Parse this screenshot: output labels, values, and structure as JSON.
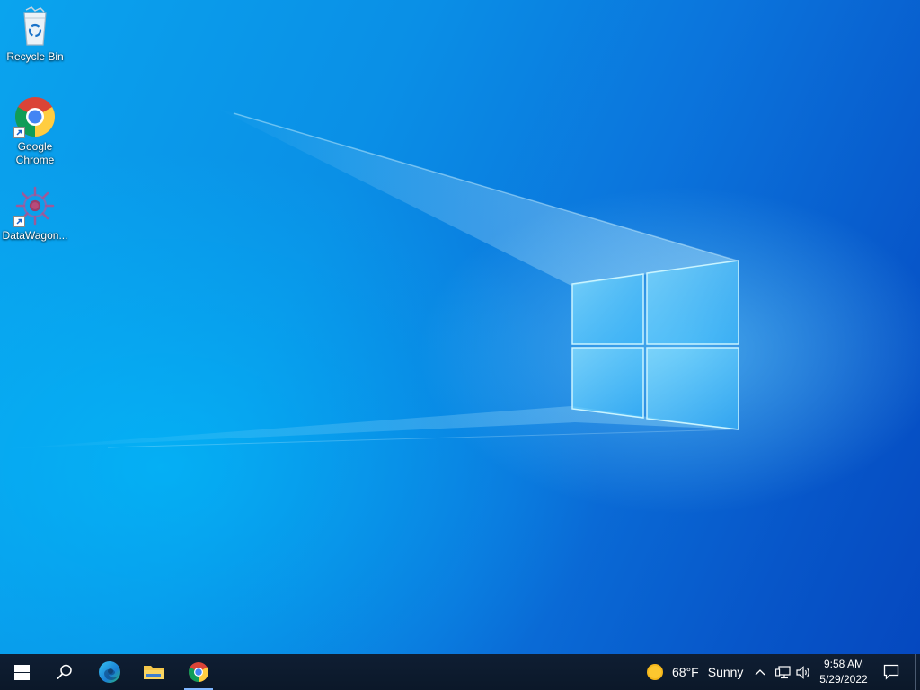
{
  "desktop": {
    "icons": [
      {
        "label": "Recycle Bin",
        "icon": "recycle-bin-icon"
      },
      {
        "label": "Google Chrome",
        "icon": "chrome-icon"
      },
      {
        "label": "DataWagon...",
        "icon": "datawagon-icon"
      }
    ],
    "wallpaper": "windows-10-logo-light-beams",
    "colors": {
      "wallpaper_light": "#0aa4ee",
      "wallpaper_dark": "#0548bf"
    }
  },
  "taskbar": {
    "pinned": [
      {
        "name": "start",
        "icon": "windows-start-icon"
      },
      {
        "name": "search",
        "icon": "search-icon"
      },
      {
        "name": "edge",
        "icon": "edge-icon"
      },
      {
        "name": "file-explorer",
        "icon": "folder-icon"
      },
      {
        "name": "chrome",
        "icon": "chrome-icon"
      }
    ],
    "weather": {
      "temp": "68°F",
      "condition": "Sunny",
      "icon": "sun-icon"
    },
    "tray": {
      "icons": [
        "chevron-up-icon",
        "network-icon",
        "volume-icon"
      ]
    },
    "clock": {
      "time": "9:58 AM",
      "date": "5/29/2022"
    },
    "notification_icon": "notification-icon",
    "color": "#0d1b2e"
  }
}
